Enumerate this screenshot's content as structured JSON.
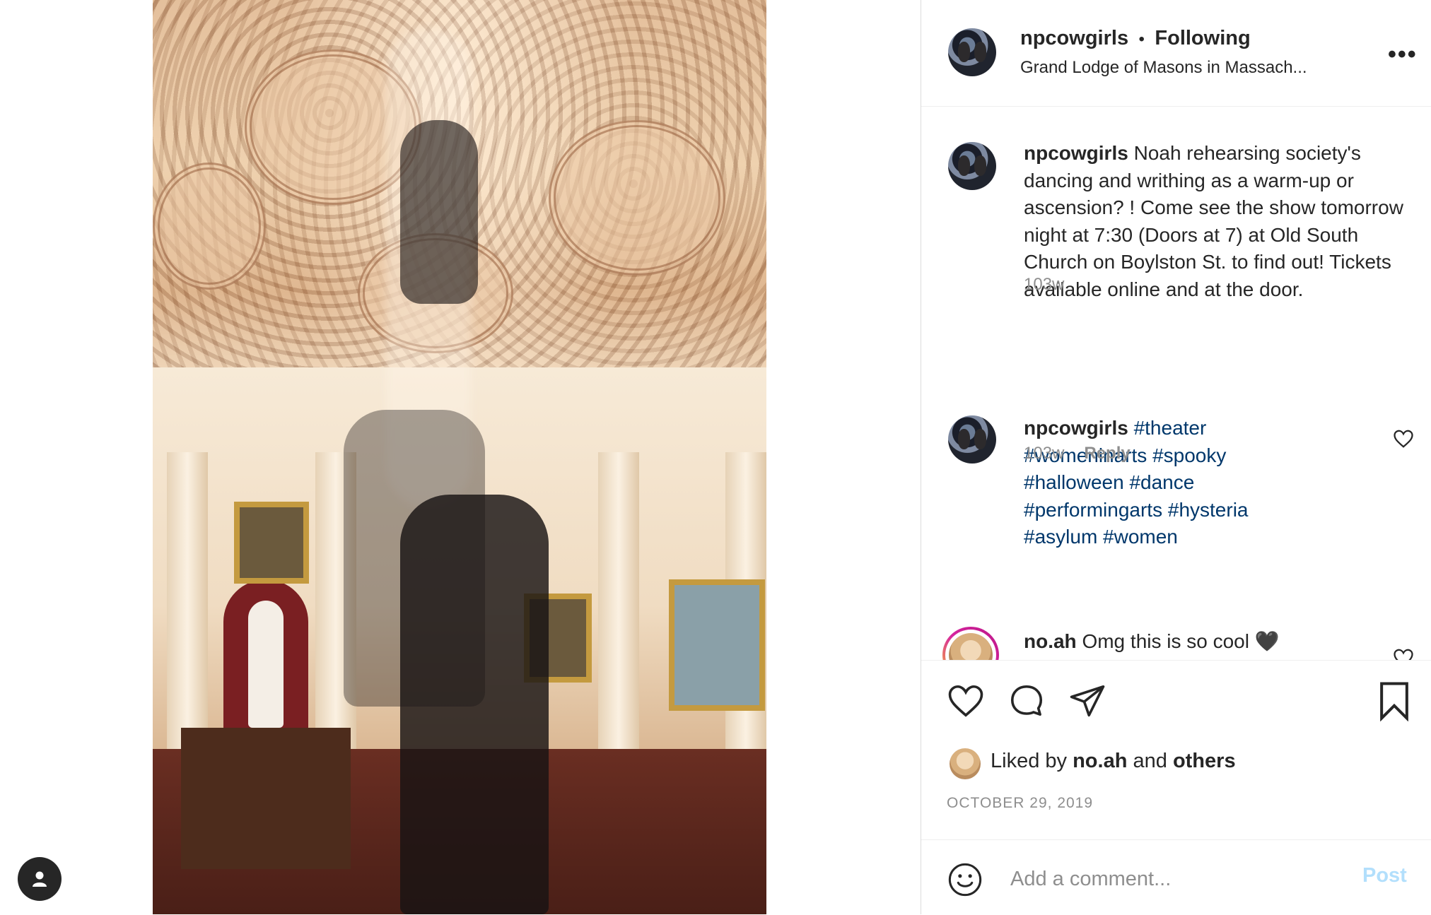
{
  "post": {
    "username": "npcowgirls",
    "separator": "•",
    "following_label": "Following",
    "location": "Grand Lodge of Masons in Massach...",
    "more_label": "•••"
  },
  "comments": [
    {
      "username": "npcowgirls",
      "text": "Noah rehearsing society's dancing and writhing as a warm-up or ascension? ! Come see the show tomorrow night at 7:30 (Doors at 7) at Old South Church on Boylston St. to find out! Tickets available online and at the door.",
      "age": "103w"
    },
    {
      "username": "npcowgirls",
      "hashtags": [
        "#theater",
        "#womeninarts",
        "#spooky",
        "#halloween",
        "#dance",
        "#performingarts",
        "#hysteria",
        "#asylum",
        "#women"
      ],
      "age": "103w",
      "reply_label": "Reply"
    },
    {
      "username": "no.ah",
      "text": "Omg this is so cool 🖤"
    }
  ],
  "likes": {
    "prefix": "Liked by",
    "user": "no.ah",
    "conjunction": "and",
    "others": "others"
  },
  "date": "OCTOBER 29, 2019",
  "add_comment": {
    "placeholder": "Add a comment...",
    "post_label": "Post"
  },
  "colors": {
    "link": "#00376b",
    "muted": "#8e8e8e",
    "post_button_disabled": "#b2dffc",
    "text": "#262626"
  },
  "icons": {
    "like": "heart-icon",
    "comment": "comment-bubble-icon",
    "share": "paper-plane-icon",
    "save": "bookmark-icon",
    "emoji": "smiley-icon",
    "more": "more-dots-icon",
    "profile": "person-icon"
  }
}
